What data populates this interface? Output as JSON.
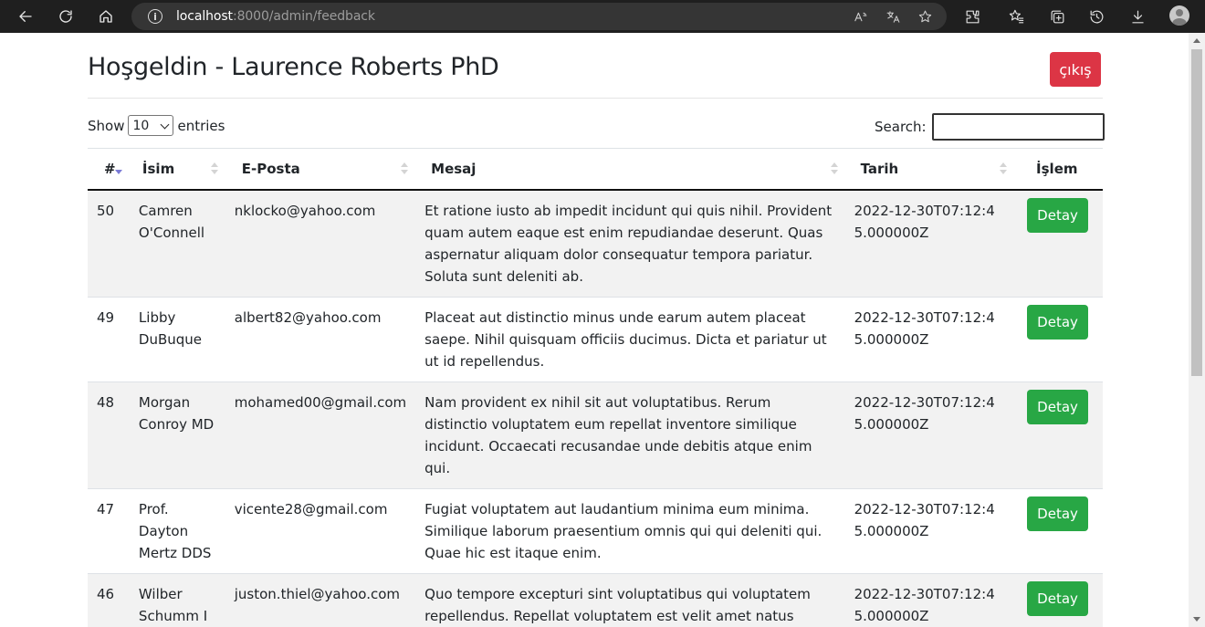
{
  "browser": {
    "url_host": "localhost",
    "url_path": ":8000/admin/feedback"
  },
  "header": {
    "title": "Hoşgeldin - Laurence Roberts PhD",
    "logout_label": "çıkış"
  },
  "datatable": {
    "show_label": "Show",
    "entries_label": "entries",
    "page_size": "10",
    "search_label": "Search:",
    "search_value": ""
  },
  "table": {
    "columns": [
      "#",
      "İsim",
      "E-Posta",
      "Mesaj",
      "Tarih",
      "İşlem"
    ],
    "sorted_column": "#",
    "sort_direction": "desc",
    "rows": [
      {
        "id": "50",
        "name": "Camren O'Connell",
        "email": "nklocko@yahoo.com",
        "message": "Et ratione iusto ab impedit incidunt qui quis nihil. Provident quam autem eaque est enim repudiandae deserunt. Quas aspernatur aliquam dolor consequatur tempora pariatur. Soluta sunt deleniti ab.",
        "date": "2022-12-30T07:12:45.000000Z",
        "action": "Detay"
      },
      {
        "id": "49",
        "name": "Libby DuBuque",
        "email": "albert82@yahoo.com",
        "message": "Placeat aut distinctio minus unde earum autem placeat saepe. Nihil quisquam officiis ducimus. Dicta et pariatur ut ut id repellendus.",
        "date": "2022-12-30T07:12:45.000000Z",
        "action": "Detay"
      },
      {
        "id": "48",
        "name": "Morgan Conroy MD",
        "email": "mohamed00@gmail.com",
        "message": "Nam provident ex nihil sit aut voluptatibus. Rerum distinctio voluptatem eum repellat inventore similique incidunt. Occaecati recusandae unde debitis atque enim qui.",
        "date": "2022-12-30T07:12:45.000000Z",
        "action": "Detay"
      },
      {
        "id": "47",
        "name": "Prof. Dayton Mertz DDS",
        "email": "vicente28@gmail.com",
        "message": "Fugiat voluptatem aut laudantium minima eum minima. Similique laborum praesentium omnis qui qui deleniti qui. Quae hic est itaque enim.",
        "date": "2022-12-30T07:12:45.000000Z",
        "action": "Detay"
      },
      {
        "id": "46",
        "name": "Wilber Schumm I",
        "email": "juston.thiel@yahoo.com",
        "message": "Quo tempore excepturi sint voluptatibus qui voluptatem repellendus. Repellat voluptatem est velit amet natus omnis et qui. Tenetur corrupti nam dolores quia ut.",
        "date": "2022-12-30T07:12:45.000000Z",
        "action": "Detay"
      }
    ]
  },
  "colors": {
    "danger": "#dc3545",
    "success": "#28a745",
    "stripe": "#f2f2f2",
    "chrome": "#1f1f1f"
  },
  "icons": [
    "back-icon",
    "reload-icon",
    "home-icon",
    "info-icon",
    "read-aloud-icon",
    "translate-icon",
    "favorite-add-icon",
    "extensions-icon",
    "favorites-icon",
    "collections-icon",
    "history-icon",
    "downloads-icon",
    "profile-avatar"
  ]
}
